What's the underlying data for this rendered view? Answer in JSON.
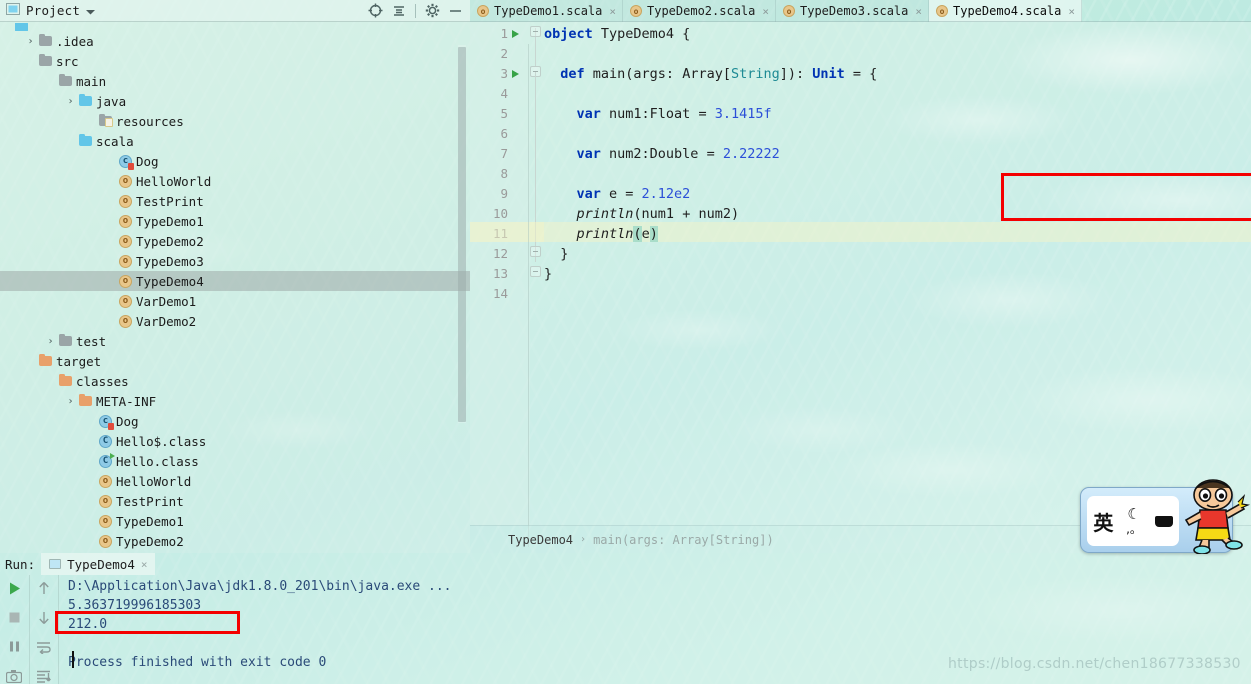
{
  "project_panel": {
    "title": "Project",
    "icons": [
      "project-view-icon",
      "chevron-down-icon",
      "locate-icon",
      "collapse-all-icon",
      "gear-icon",
      "minimize-icon"
    ],
    "tree": [
      {
        "indent": 1,
        "arrow": "›",
        "icon": "folder-gray",
        "label": ".idea"
      },
      {
        "indent": 1,
        "arrow": "ⱟ",
        "icon": "folder-gray",
        "label": "src"
      },
      {
        "indent": 2,
        "arrow": "ⱟ",
        "icon": "folder-gray",
        "label": "main"
      },
      {
        "indent": 3,
        "arrow": "›",
        "icon": "folder-blue",
        "label": "java"
      },
      {
        "indent": 4,
        "arrow": "",
        "icon": "folder-resources",
        "label": "resources"
      },
      {
        "indent": 3,
        "arrow": "ⱟ",
        "icon": "folder-blue",
        "label": "scala"
      },
      {
        "indent": 5,
        "arrow": "",
        "icon": "scala-class-icon",
        "label": "Dog"
      },
      {
        "indent": 5,
        "arrow": "",
        "icon": "scala-object-icon",
        "label": "HelloWorld"
      },
      {
        "indent": 5,
        "arrow": "",
        "icon": "scala-object-icon",
        "label": "TestPrint"
      },
      {
        "indent": 5,
        "arrow": "",
        "icon": "scala-object-icon",
        "label": "TypeDemo1"
      },
      {
        "indent": 5,
        "arrow": "",
        "icon": "scala-object-icon",
        "label": "TypeDemo2"
      },
      {
        "indent": 5,
        "arrow": "",
        "icon": "scala-object-icon",
        "label": "TypeDemo3"
      },
      {
        "indent": 5,
        "arrow": "",
        "icon": "scala-object-icon",
        "label": "TypeDemo4",
        "selected": true
      },
      {
        "indent": 5,
        "arrow": "",
        "icon": "scala-object-icon",
        "label": "VarDemo1"
      },
      {
        "indent": 5,
        "arrow": "",
        "icon": "scala-object-icon",
        "label": "VarDemo2"
      },
      {
        "indent": 2,
        "arrow": "›",
        "icon": "folder-gray",
        "label": "test"
      },
      {
        "indent": 1,
        "arrow": "ⱟ",
        "icon": "folder-orange",
        "label": "target"
      },
      {
        "indent": 2,
        "arrow": "ⱟ",
        "icon": "folder-orange",
        "label": "classes"
      },
      {
        "indent": 3,
        "arrow": "›",
        "icon": "folder-orange",
        "label": "META-INF"
      },
      {
        "indent": 4,
        "arrow": "",
        "icon": "scala-class-icon",
        "label": "Dog"
      },
      {
        "indent": 4,
        "arrow": "",
        "icon": "class-icon",
        "label": "Hello$.class"
      },
      {
        "indent": 4,
        "arrow": "",
        "icon": "class-runnable-icon",
        "label": "Hello.class"
      },
      {
        "indent": 4,
        "arrow": "",
        "icon": "scala-object-icon",
        "label": "HelloWorld"
      },
      {
        "indent": 4,
        "arrow": "",
        "icon": "scala-object-icon",
        "label": "TestPrint"
      },
      {
        "indent": 4,
        "arrow": "",
        "icon": "scala-object-icon",
        "label": "TypeDemo1"
      },
      {
        "indent": 4,
        "arrow": "",
        "icon": "scala-object-icon",
        "label": "TypeDemo2"
      }
    ]
  },
  "editor": {
    "tabs": [
      {
        "label": "TypeDemo1.scala",
        "active": false,
        "icon": "scala-object-icon",
        "close": "×"
      },
      {
        "label": "TypeDemo2.scala",
        "active": false,
        "icon": "scala-object-icon",
        "close": "×"
      },
      {
        "label": "TypeDemo3.scala",
        "active": false,
        "icon": "scala-object-icon",
        "close": "×"
      },
      {
        "label": "TypeDemo4.scala",
        "active": true,
        "icon": "scala-object-icon",
        "close": "×"
      }
    ],
    "line_numbers": [
      "1",
      "2",
      "3",
      "4",
      "5",
      "6",
      "7",
      "8",
      "9",
      "10",
      "11",
      "12",
      "13",
      "14"
    ],
    "run_markers_on_lines": [
      1,
      3
    ],
    "current_line": 11,
    "code_lines": [
      {
        "n": 1,
        "text": "object TypeDemo4 {"
      },
      {
        "n": 2,
        "text": ""
      },
      {
        "n": 3,
        "text": "  def main(args: Array[String]): Unit = {"
      },
      {
        "n": 4,
        "text": ""
      },
      {
        "n": 5,
        "text": "    var num1:Float = 3.1415f"
      },
      {
        "n": 6,
        "text": ""
      },
      {
        "n": 7,
        "text": "    var num2:Double = 2.22222"
      },
      {
        "n": 8,
        "text": ""
      },
      {
        "n": 9,
        "text": "    var e = 2.12e2"
      },
      {
        "n": 10,
        "text": "    println(num1 + num2)"
      },
      {
        "n": 11,
        "text": "    println(e)"
      },
      {
        "n": 12,
        "text": "  }"
      },
      {
        "n": 13,
        "text": "}"
      },
      {
        "n": 14,
        "text": ""
      }
    ],
    "highlight_box": {
      "color": "#f40000",
      "lines": [
        9,
        10
      ]
    },
    "breadcrumb": {
      "class": "TypeDemo4",
      "separator": "›",
      "method": "main(args: Array[String])"
    }
  },
  "run_panel": {
    "label": "Run:",
    "tab": {
      "label": "TypeDemo4",
      "close": "×",
      "icon": "run-config-icon"
    },
    "tools_left": [
      "rerun-icon",
      "stop-icon",
      "pause-icon",
      "screenshot-icon"
    ],
    "tools_right": [
      "up-arrow-icon",
      "down-arrow-icon",
      "soft-wrap-icon",
      "scroll-to-end-icon"
    ],
    "console_lines": [
      "D:\\Application\\Java\\jdk1.8.0_201\\bin\\java.exe ...",
      "5.363719996185303",
      "212.0",
      "",
      "Process finished with exit code 0"
    ],
    "highlight_box": {
      "color": "#f40000",
      "line_text": "212.0"
    }
  },
  "ime_bar": {
    "mode_label": "英",
    "moon_icon": "moon-icon",
    "dots_label": ",。",
    "keyboard_icon": "keyboard-icon",
    "mascot": "crayon-shinchan-mascot"
  },
  "watermark": {
    "text": "https://blog.csdn.net/chen18677338530"
  },
  "colors": {
    "background": "#cdf1ea",
    "accent_red": "#f40000",
    "keyword_blue": "#0033b3",
    "number_blue": "#2b4fd8",
    "type_teal": "#1d8a94",
    "selection_gray": "#9eaaa8",
    "current_line": "#f3f3c8"
  }
}
